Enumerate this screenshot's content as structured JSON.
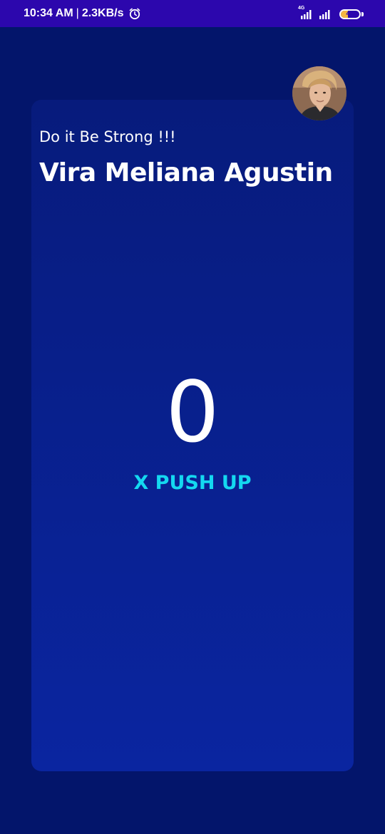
{
  "status_bar": {
    "time": "10:34 AM",
    "separator": "|",
    "network_speed": "2.3KB/s",
    "network_type": "4G",
    "battery_level": "40",
    "battery_fraction": 0.4,
    "colors": {
      "background": "#2c07ad",
      "battery_fill": "#f5b642"
    },
    "icons": [
      "alarm-icon",
      "signal-icon",
      "signal-icon",
      "battery-icon"
    ]
  },
  "profile": {
    "avatar_icon": "user-avatar-photo"
  },
  "header": {
    "motto": "Do it Be Strong !!!",
    "user_name": "Vira Meliana Agustin"
  },
  "counter": {
    "value": "0",
    "label": "X PUSH UP"
  },
  "colors": {
    "page_background": "#03156b",
    "card_top": "#071b7c",
    "card_bottom": "#0a25a0",
    "accent": "#14d8f0",
    "text": "#ffffff"
  }
}
